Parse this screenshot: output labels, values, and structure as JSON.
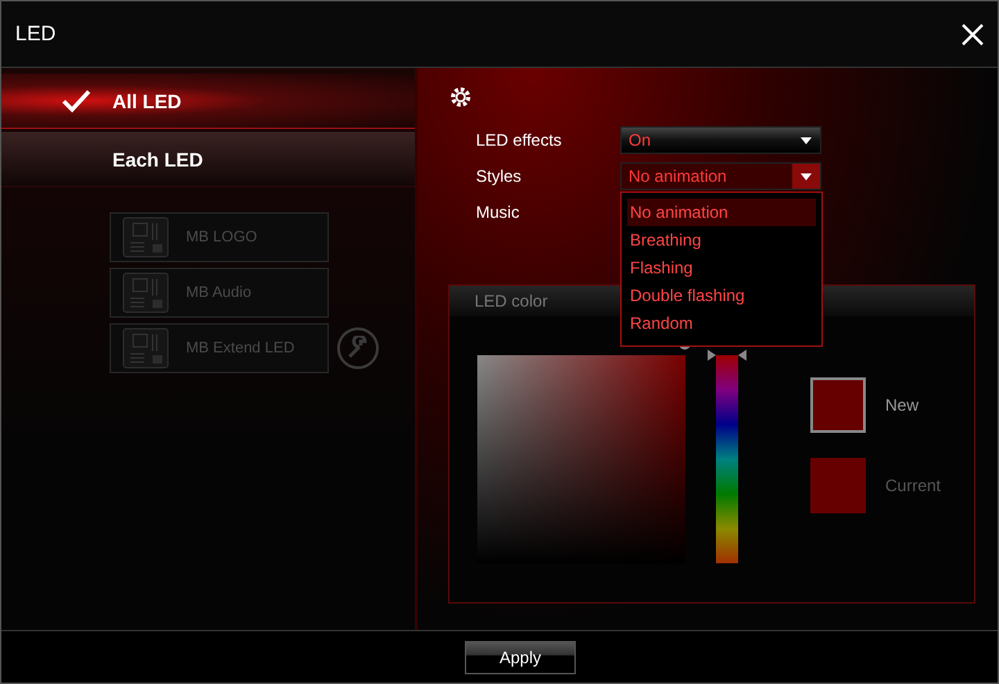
{
  "window": {
    "title": "LED"
  },
  "modes": [
    {
      "label": "All LED",
      "selected": true
    },
    {
      "label": "Each LED",
      "selected": false
    }
  ],
  "devices": [
    {
      "label": "MB LOGO",
      "disabled": true
    },
    {
      "label": "MB Audio",
      "disabled": true
    },
    {
      "label": "MB Extend LED",
      "disabled": true
    }
  ],
  "settings": [
    {
      "kind": "dropdown",
      "label": "LED effects",
      "value": "On",
      "open": false
    },
    {
      "kind": "dropdown",
      "label": "Styles",
      "value": "No animation",
      "open": true
    },
    {
      "kind": "plain",
      "label": "Music"
    }
  ],
  "styles_menu": [
    {
      "label": "No animation",
      "selected": true
    },
    {
      "label": "Breathing",
      "selected": false
    },
    {
      "label": "Flashing",
      "selected": false
    },
    {
      "label": "Double flashing",
      "selected": false
    },
    {
      "label": "Random",
      "selected": false
    }
  ],
  "led_color": {
    "title": "LED color",
    "hue_slider": {
      "level": 1
    },
    "swatches": [
      {
        "label": "New",
        "color": "#660000",
        "selected": true
      },
      {
        "label": "Current",
        "color": "#660000",
        "selected": false
      }
    ]
  },
  "apply_button": "Apply"
}
